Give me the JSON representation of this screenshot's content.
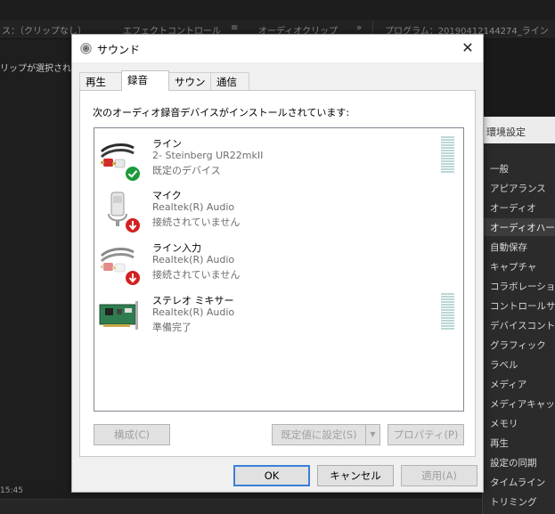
{
  "background": {
    "panel_titles": [
      "ス：（クリップなし）",
      "エフェクトコントロール",
      "≡",
      "オーディオクリップ",
      "»",
      "プログラム：20190412144274_ライン"
    ],
    "left_text": "リップが選択されて",
    "timecode": "15:45",
    "preferences": {
      "title": "環境設定",
      "items": [
        "一般",
        "アピアランス",
        "オーディオ",
        "オーディオハード",
        "自動保存",
        "キャプチャ",
        "コラボレーション",
        "コントロールサーフ",
        "デバイスコントロール",
        "グラフィック",
        "ラベル",
        "メディア",
        "メディアキャッシュ",
        "メモリ",
        "再生",
        "設定の同期",
        "タイムライン",
        "トリミング"
      ],
      "selected_index": 3
    }
  },
  "dialog": {
    "title": "サウンド",
    "close_glyph": "✕",
    "tabs": [
      "再生",
      "録音",
      "サウンド",
      "通信"
    ],
    "active_tab": 1,
    "instruction": "次のオーディオ録音デバイスがインストールされています:",
    "devices": [
      {
        "name": "ライン",
        "sub": "2- Steinberg UR22mkII",
        "status": "既定のデバイス",
        "icon": "line-in-cable-icon",
        "badge": "default-check-icon",
        "has_meter": true
      },
      {
        "name": "マイク",
        "sub": "Realtek(R) Audio",
        "status": "接続されていません",
        "icon": "microphone-icon",
        "badge": "disconnected-arrow-icon",
        "has_meter": false
      },
      {
        "name": "ライン入力",
        "sub": "Realtek(R) Audio",
        "status": "接続されていません",
        "icon": "line-in-cable-icon",
        "badge": "disconnected-arrow-icon",
        "has_meter": false
      },
      {
        "name": "ステレオ ミキサー",
        "sub": "Realtek(R) Audio",
        "status": "準備完了",
        "icon": "sound-card-icon",
        "badge": "",
        "has_meter": true
      }
    ],
    "buttons": {
      "configure": "構成(C)",
      "set_default": "既定値に設定(S)",
      "properties": "プロパティ(P)",
      "ok": "OK",
      "cancel": "キャンセル",
      "apply": "適用(A)"
    },
    "colors": {
      "accent": "#3c7fd6",
      "check_green": "#1d9b3a",
      "disconnected_red": "#d32020",
      "meter": "#b9d8d8"
    }
  }
}
